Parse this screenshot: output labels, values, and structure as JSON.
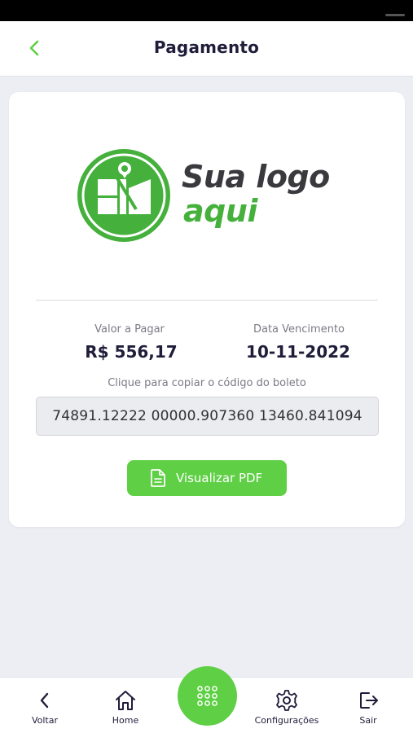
{
  "header": {
    "title": "Pagamento",
    "back_icon": "chevron-left-icon"
  },
  "logo": {
    "line1": "Sua logo",
    "line2": "aqui"
  },
  "payment": {
    "amount_label": "Valor a Pagar",
    "amount_value": "R$ 556,17",
    "due_label": "Data Vencimento",
    "due_value": "10-11-2022",
    "copy_hint": "Clique para copiar o código do boleto",
    "barcode": "74891.12222 00000.907360 13460.841094"
  },
  "pdf_button": {
    "label": "Visualizar PDF",
    "icon": "document-icon"
  },
  "bottom_nav": {
    "items": [
      {
        "label": "Voltar",
        "icon": "chevron-left-icon"
      },
      {
        "label": "Home",
        "icon": "home-icon"
      },
      {
        "label": "Configurações",
        "icon": "gear-icon"
      },
      {
        "label": "Sair",
        "icon": "logout-icon"
      }
    ],
    "fab_icon": "grid-dots-icon"
  },
  "colors": {
    "accent": "#5fcf45",
    "logo_green": "#45b13c",
    "text_dark": "#1f1d3a",
    "background": "#eceef3"
  }
}
